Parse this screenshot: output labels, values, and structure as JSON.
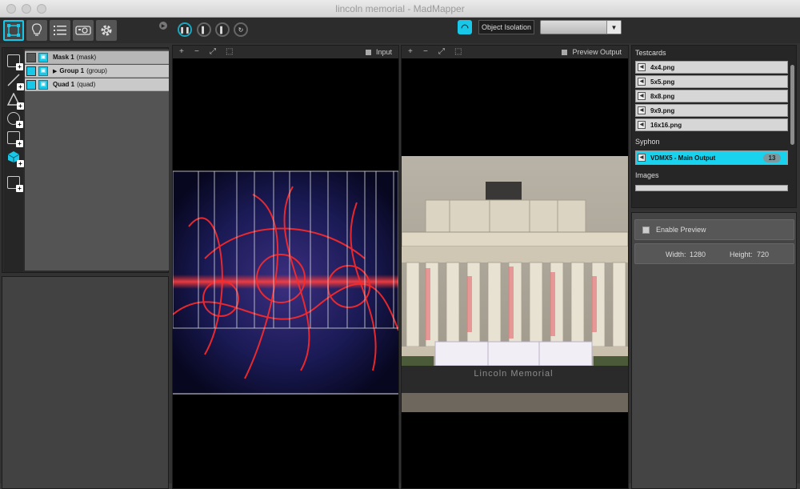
{
  "window": {
    "title": "lincoln memorial - MadMapper"
  },
  "toolbar": {
    "isolation_label": "Object Isolation",
    "isolation_value": ""
  },
  "layers": [
    {
      "name": "Mask 1",
      "kind": "(mask)",
      "visible": false
    },
    {
      "name": "Group 1",
      "kind": "(group)",
      "visible": true
    },
    {
      "name": "Quad 1",
      "kind": "(quad)",
      "visible": true
    }
  ],
  "input_view": {
    "label": "Input"
  },
  "output_view": {
    "label": "Preview Output",
    "caption_text": "Lincoln Memorial"
  },
  "media": {
    "testcards_heading": "Testcards",
    "testcards": [
      "4x4.png",
      "5x5.png",
      "8x8.png",
      "9x9.png",
      "16x16.png"
    ],
    "syphon_heading": "Syphon",
    "syphon_item": "VDMX5 - Main Output",
    "syphon_count": "13",
    "images_heading": "Images"
  },
  "preview": {
    "enable_label": "Enable Preview",
    "width_label": "Width:",
    "width_value": "1280",
    "height_label": "Height:",
    "height_value": "720"
  },
  "colors": {
    "accent": "#19c8e8",
    "panel": "#323232"
  }
}
